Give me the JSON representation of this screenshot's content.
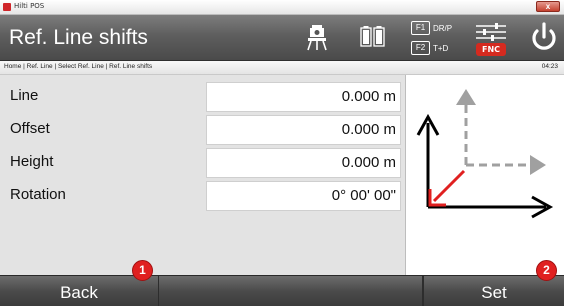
{
  "window": {
    "title": "Hilti POS",
    "close_glyph": "x"
  },
  "header": {
    "title": "Ref. Line shifts",
    "icons": [
      "tripod-icon",
      "battery-icon",
      "fnc-settings-icon",
      "power-icon"
    ],
    "fkeys": [
      {
        "key": "F1",
        "label": "DR/P"
      },
      {
        "key": "F2",
        "label": "T+D"
      }
    ],
    "fnc_label": "FNC"
  },
  "breadcrumb": {
    "path": "Home | Ref. Line | Select Ref. Line | Ref. Line shifts",
    "time": "04:23"
  },
  "fields": [
    {
      "label": "Line",
      "value": "0.000 m"
    },
    {
      "label": "Offset",
      "value": "0.000 m"
    },
    {
      "label": "Height",
      "value": "0.000 m"
    },
    {
      "label": "Rotation",
      "value": "0° 00' 00\""
    }
  ],
  "footer": {
    "back_label": "Back",
    "set_label": "Set"
  },
  "callouts": [
    "1",
    "2"
  ],
  "colors": {
    "accent_red": "#d52a1f",
    "header_gray": "#5e5e5e",
    "arrow_gray": "#a0a0a0"
  }
}
